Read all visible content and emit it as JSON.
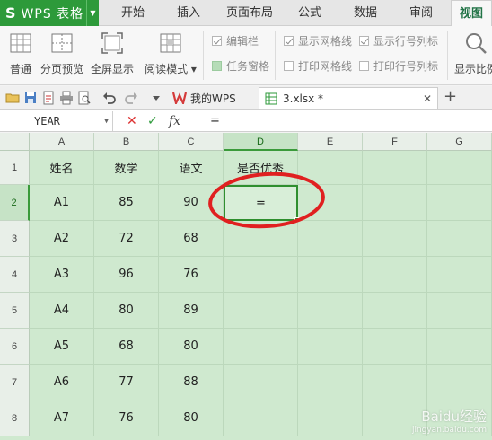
{
  "app": {
    "logo": "S",
    "title": "WPS 表格",
    "accent": "#2d9a3a"
  },
  "menu": {
    "tabs": [
      "开始",
      "插入",
      "页面布局",
      "公式",
      "数据",
      "审阅",
      "视图"
    ],
    "active": "视图"
  },
  "ribbon": {
    "view_buttons": [
      "普通",
      "分页预览",
      "全屏显示",
      "阅读模式"
    ],
    "read_mode_dropdown": "▾",
    "checks": [
      {
        "label": "编辑栏",
        "checked": true
      },
      {
        "label": "任务窗格",
        "checked": false
      },
      {
        "label": "显示网格线",
        "checked": true
      },
      {
        "label": "打印网格线",
        "checked": false
      },
      {
        "label": "显示行号列标",
        "checked": true
      },
      {
        "label": "打印行号列标",
        "checked": false
      }
    ],
    "zoom_label": "显示比例"
  },
  "doc_tabs": [
    {
      "label": "我的WPS",
      "active": false
    },
    {
      "label": "3.xlsx *",
      "active": true
    }
  ],
  "new_tab": "+",
  "formula_bar": {
    "name_box": "YEAR",
    "cancel": "✕",
    "confirm": "✓",
    "fx": "fx",
    "content": "="
  },
  "sheet": {
    "columns": [
      "A",
      "B",
      "C",
      "D",
      "E",
      "F",
      "G"
    ],
    "rows": [
      "1",
      "2",
      "3",
      "4",
      "5",
      "6",
      "7",
      "8"
    ],
    "active_cell": "D2",
    "data": [
      [
        "姓名",
        "数学",
        "语文",
        "是否优秀",
        "",
        "",
        ""
      ],
      [
        "A1",
        "85",
        "90",
        "=",
        "",
        "",
        ""
      ],
      [
        "A2",
        "72",
        "68",
        "",
        "",
        "",
        ""
      ],
      [
        "A3",
        "96",
        "76",
        "",
        "",
        "",
        ""
      ],
      [
        "A4",
        "80",
        "89",
        "",
        "",
        "",
        ""
      ],
      [
        "A5",
        "68",
        "80",
        "",
        "",
        "",
        ""
      ],
      [
        "A6",
        "77",
        "88",
        "",
        "",
        "",
        ""
      ],
      [
        "A7",
        "76",
        "80",
        "",
        "",
        "",
        ""
      ]
    ],
    "grid_color": "#cfe9cf",
    "annotation_color": "#e02020"
  },
  "watermark": {
    "text": "Baidu经验",
    "sub": "jingyan.baidu.com"
  }
}
